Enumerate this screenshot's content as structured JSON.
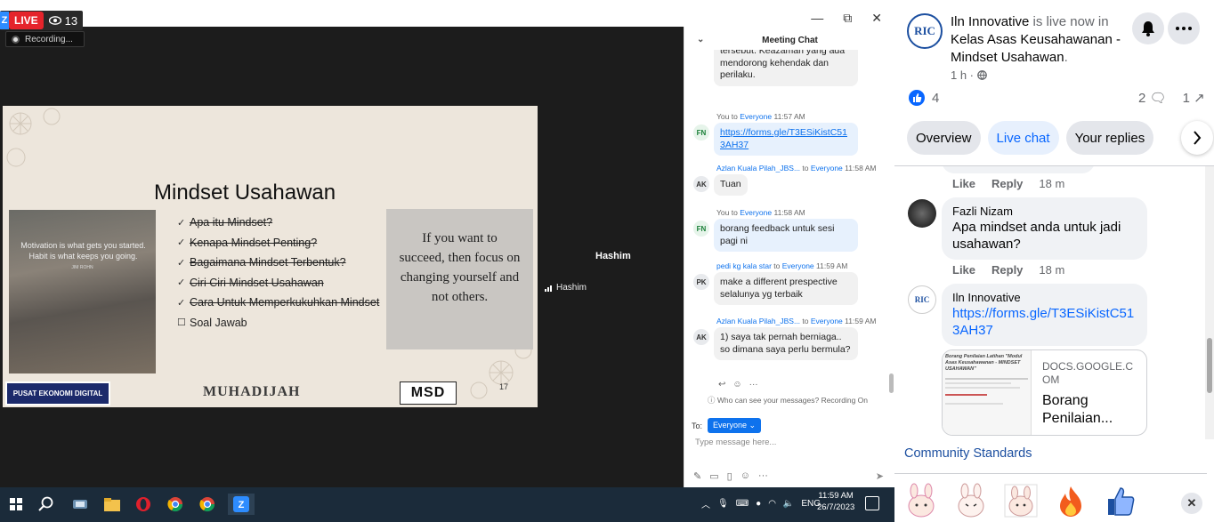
{
  "zoom": {
    "logo_letter": "Z",
    "live_label": "LIVE",
    "viewer_count": "13",
    "recording_label": "Recording...",
    "window_controls": [
      "—",
      "⧉",
      "✕"
    ]
  },
  "slide": {
    "title": "Mindset Usahawan",
    "photo_quote": "Motivation is what gets you started. Habit is what keeps you going.",
    "photo_author": "JIM ROHN",
    "agenda": [
      {
        "text": "Apa itu Mindset?",
        "done": true
      },
      {
        "text": "Kenapa Mindset Penting?",
        "done": true
      },
      {
        "text": "Bagaimana Mindset Terbentuk?",
        "done": true
      },
      {
        "text": "Ciri Ciri Mindset Usahawan",
        "done": true
      },
      {
        "text": "Cara Untuk Memperkukuhkan Mindset",
        "done": true
      },
      {
        "text": "Soal Jawab",
        "done": false
      }
    ],
    "quote": "If you want to succeed, then focus on changing yourself and not others.",
    "footer_logo_left": "PUSAT EKONOMI DIGITAL",
    "footer_logo_mid": "MUHADIJAH",
    "footer_logo_right": "MSD",
    "page_number": "17"
  },
  "participant": {
    "name": "Hashim",
    "tag_name": "Hashim"
  },
  "chat": {
    "title": "Meeting Chat",
    "messages": [
      {
        "partial": true,
        "text": "tersebut.  Keazaman yang ada mendorong kehendak dan perilaku."
      },
      {
        "avatar": "FN",
        "sender": "You",
        "to": "Everyone",
        "time": "11:57 AM",
        "link": "https://forms.gle/T3ESiKistC513AH37"
      },
      {
        "avatar": "AK",
        "sender": "Azlan Kuala Pilah_JBS...",
        "to": "Everyone",
        "time": "11:58 AM",
        "text": "Tuan"
      },
      {
        "avatar": "FN",
        "sender": "You",
        "to": "Everyone",
        "time": "11:58 AM",
        "text": "borang feedback untuk sesi pagi ni"
      },
      {
        "avatar": "PK",
        "sender": "pedi kg kala star",
        "to": "Everyone",
        "time": "11:59 AM",
        "text": "make a different prespective selalunya yg terbaik"
      },
      {
        "avatar": "AK",
        "sender": "Azlan Kuala Pilah_JBS...",
        "to": "Everyone",
        "time": "11:59 AM",
        "text": "1) saya tak pernah berniaga.. so dimana saya perlu bermula?"
      }
    ],
    "to_word": "to",
    "who_can_see": "Who can see your messages? Recording On",
    "to_label": "To:",
    "recipient": "Everyone",
    "input_placeholder": "Type message here..."
  },
  "taskbar": {
    "language": "ENG",
    "time": "11:59 AM",
    "date": "26/7/2023"
  },
  "facebook": {
    "page_name": "Iln Innovative",
    "live_text": " is live now in ",
    "event_name": "Kelas Asas Keusahawanan - Mindset Usahawan",
    "post_age": "1 h ·",
    "like_count": "4",
    "comment_count": "2",
    "share_count": "1",
    "tabs": [
      "Overview",
      "Live chat",
      "Your replies"
    ],
    "active_tab": 1,
    "comments": [
      {
        "author": "Fazli Nizam",
        "text": "Apa mindset anda untuk jadi usahawan?",
        "age": "18 m"
      },
      {
        "author": "Iln Innovative",
        "link": "https://forms.gle/T3ESiKistC513AH37"
      }
    ],
    "like_action": "Like",
    "reply_action": "Reply",
    "first_row_age": "18 m",
    "link_card": {
      "domain": "DOCS.GOOGLE.COM",
      "title": "Borang Penilaian...",
      "thumb_title": "Borang Penilaian Latihan \"Modul Asas Keusahawanan - MINDSET USAHAWAN\""
    },
    "community_standards": "Community Standards"
  },
  "colors": {
    "zoom_blue": "#0e72ed",
    "live_red": "#e5242b",
    "fb_blue": "#0866ff",
    "taskbar": "#1b2b3a"
  }
}
